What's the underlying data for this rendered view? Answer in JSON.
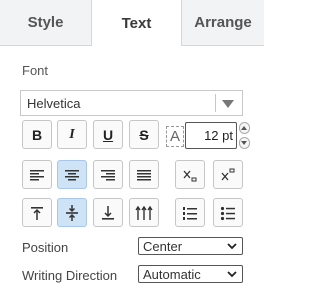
{
  "tabs": {
    "style": "Style",
    "text": "Text",
    "arrange": "Arrange",
    "active": "text"
  },
  "font": {
    "heading": "Font",
    "family": "Helvetica",
    "bold_label": "B",
    "italic_label": "I",
    "underline_label": "U",
    "strike_label": "S",
    "size_icon_label": "A",
    "size_value": "12 pt"
  },
  "alignment": {
    "horizontal_selected": "center",
    "vertical_selected": "middle"
  },
  "position": {
    "label": "Position",
    "value": "Center"
  },
  "writing_direction": {
    "label": "Writing Direction",
    "value": "Automatic"
  },
  "colors": {
    "active_button": "#cfe3f7",
    "tab_inactive_bg": "#f1f3f4"
  }
}
